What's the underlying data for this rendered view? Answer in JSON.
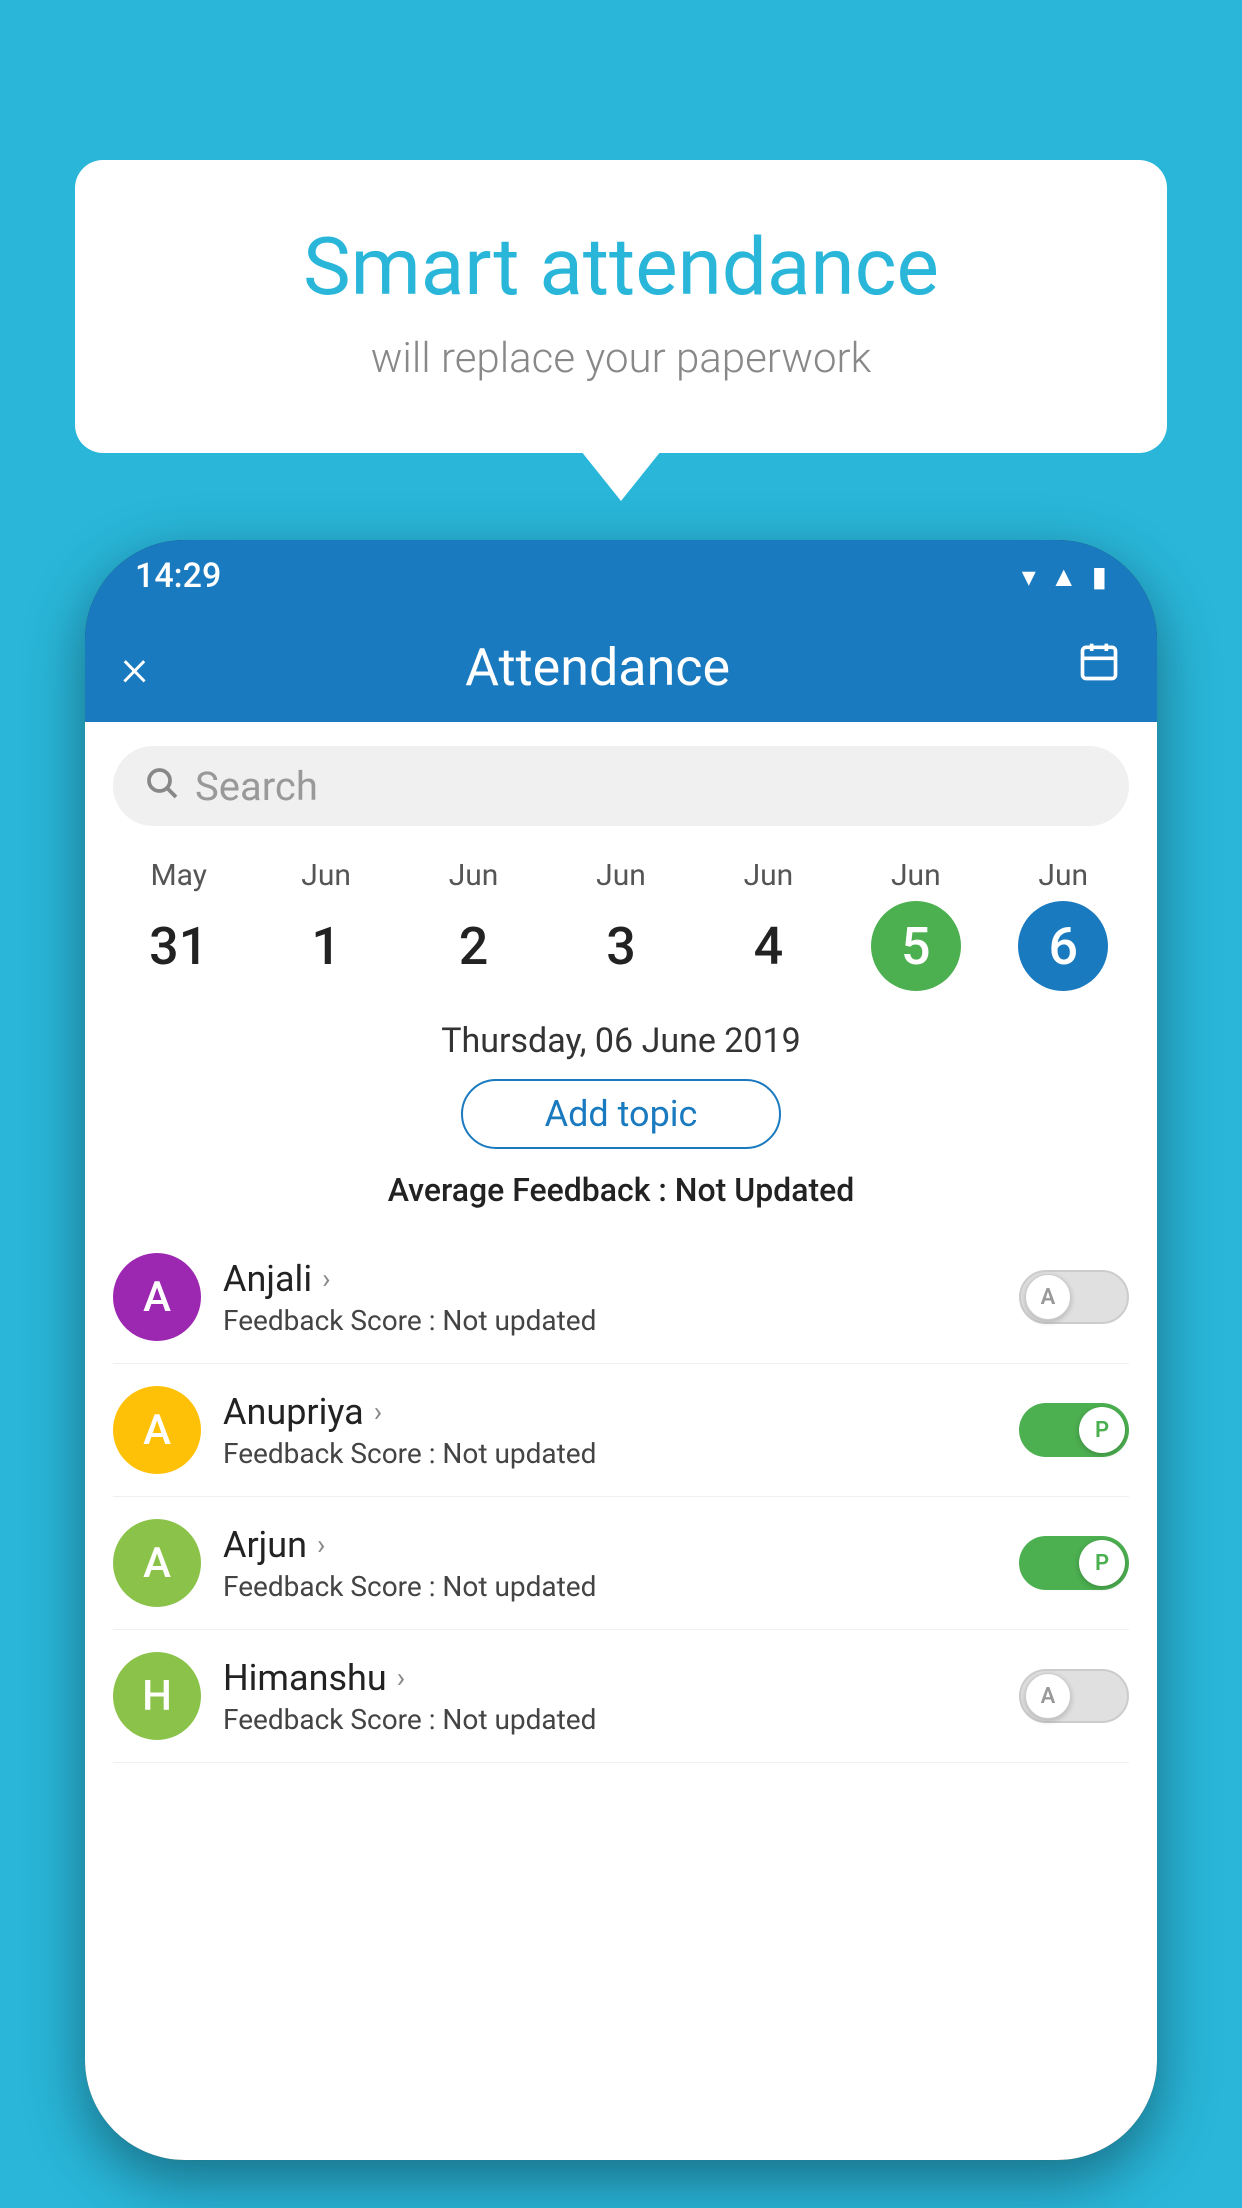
{
  "background_color": "#29B6D9",
  "bubble": {
    "title": "Smart attendance",
    "subtitle": "will replace your paperwork"
  },
  "phone": {
    "status_bar": {
      "time": "14:29"
    },
    "app_bar": {
      "title": "Attendance",
      "close_label": "×",
      "calendar_icon": "📅"
    },
    "search": {
      "placeholder": "Search"
    },
    "dates": [
      {
        "month": "May",
        "day": "31",
        "style": "normal"
      },
      {
        "month": "Jun",
        "day": "1",
        "style": "normal"
      },
      {
        "month": "Jun",
        "day": "2",
        "style": "normal"
      },
      {
        "month": "Jun",
        "day": "3",
        "style": "normal"
      },
      {
        "month": "Jun",
        "day": "4",
        "style": "normal"
      },
      {
        "month": "Jun",
        "day": "5",
        "style": "green"
      },
      {
        "month": "Jun",
        "day": "6",
        "style": "blue"
      }
    ],
    "selected_date": "Thursday, 06 June 2019",
    "add_topic_label": "Add topic",
    "avg_feedback_label": "Average Feedback : ",
    "avg_feedback_value": "Not Updated",
    "students": [
      {
        "name": "Anjali",
        "avatar_letter": "A",
        "avatar_color": "#9C27B0",
        "feedback_label": "Feedback Score : ",
        "feedback_value": "Not updated",
        "toggle_state": "off",
        "toggle_label": "A"
      },
      {
        "name": "Anupriya",
        "avatar_letter": "A",
        "avatar_color": "#FFC107",
        "feedback_label": "Feedback Score : ",
        "feedback_value": "Not updated",
        "toggle_state": "on",
        "toggle_label": "P"
      },
      {
        "name": "Arjun",
        "avatar_letter": "A",
        "avatar_color": "#8BC34A",
        "feedback_label": "Feedback Score : ",
        "feedback_value": "Not updated",
        "toggle_state": "on",
        "toggle_label": "P"
      },
      {
        "name": "Himanshu",
        "avatar_letter": "H",
        "avatar_color": "#8BC34A",
        "feedback_label": "Feedback Score : ",
        "feedback_value": "Not updated",
        "toggle_state": "off",
        "toggle_label": "A"
      }
    ]
  }
}
